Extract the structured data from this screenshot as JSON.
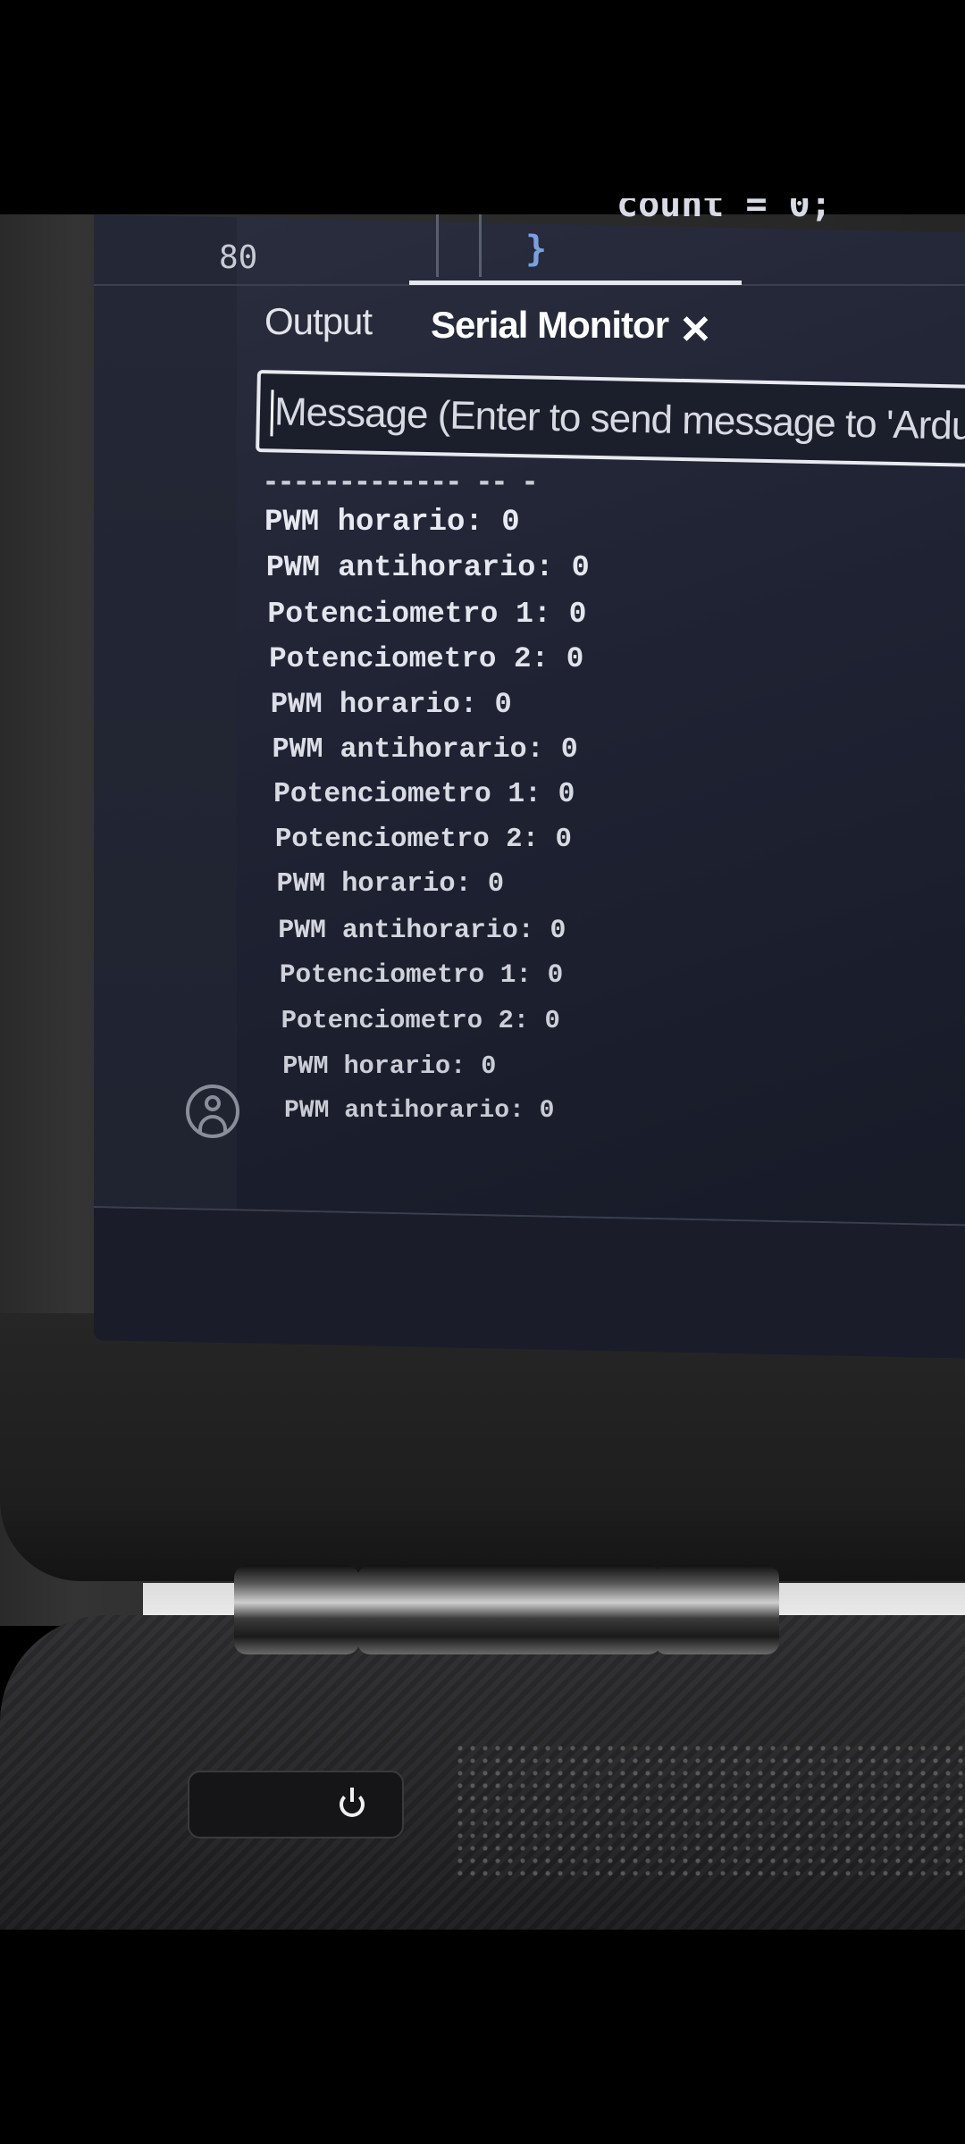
{
  "editor": {
    "line_number": "80",
    "code_brace": "}",
    "code_partial": "count = 0;"
  },
  "panel": {
    "tabs": [
      {
        "label": "Output"
      },
      {
        "label": "Serial Monitor"
      }
    ],
    "close_glyph": "✕",
    "message_placeholder": "Message (Enter to send message to 'Ardui"
  },
  "serial_output": {
    "partial_line": "-------------  --  -",
    "lines": [
      "PWM horario: 0",
      "PWM antihorario: 0",
      "Potenciometro 1: 0",
      "Potenciometro 2: 0",
      "PWM horario: 0",
      "PWM antihorario: 0",
      "Potenciometro 1: 0",
      "Potenciometro 2: 0",
      "PWM horario: 0",
      "PWM antihorario: 0",
      "Potenciometro 1: 0",
      "Potenciometro 2: 0",
      "PWM horario: 0",
      "PWM antihorario: 0"
    ]
  },
  "icons": {
    "account": "account-icon",
    "power": "power-icon"
  }
}
